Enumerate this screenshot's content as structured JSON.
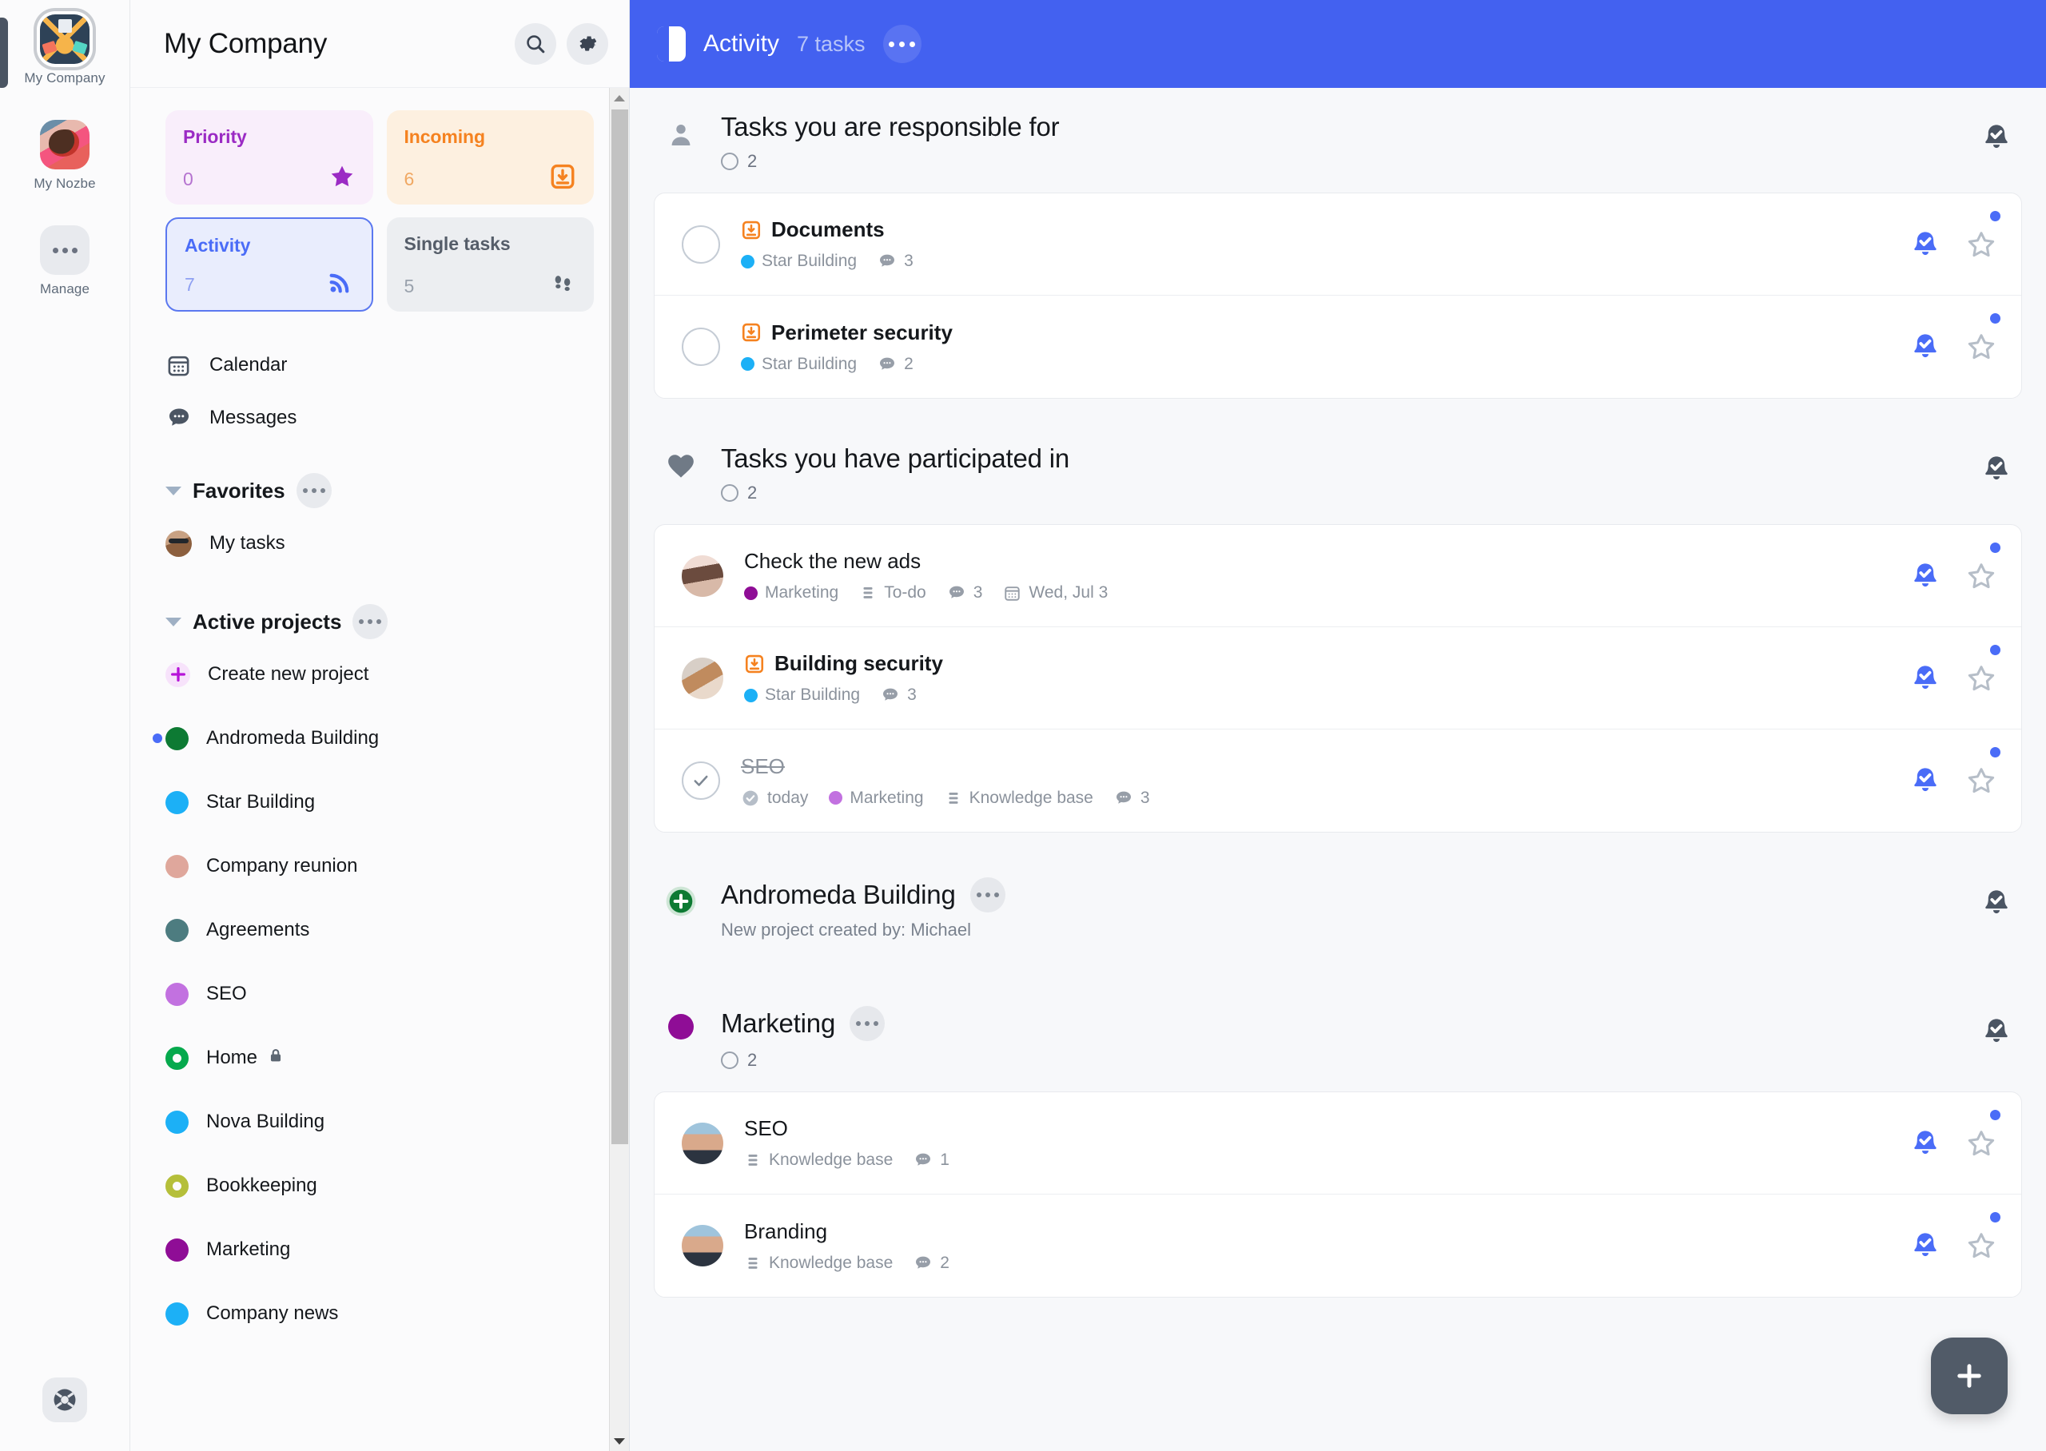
{
  "rail": {
    "items": [
      {
        "label": "My Company",
        "icon": "company-avatar",
        "selected": true
      },
      {
        "label": "My Nozbe",
        "icon": "nozbe-avatar",
        "selected": false
      },
      {
        "label": "Manage",
        "icon": "ellipsis-icon",
        "selected": false
      }
    ],
    "help_icon": "lifebuoy-icon"
  },
  "sidebar": {
    "title": "My Company",
    "search_icon": "search-icon",
    "settings_icon": "gear-icon",
    "tiles": [
      {
        "name": "Priority",
        "count": "0",
        "icon": "star-icon",
        "key": "priority"
      },
      {
        "name": "Incoming",
        "count": "6",
        "icon": "inbox-download-icon",
        "key": "incoming"
      },
      {
        "name": "Activity",
        "count": "7",
        "icon": "rss-icon",
        "key": "activity",
        "selected": true
      },
      {
        "name": "Single tasks",
        "count": "5",
        "icon": "footprints-icon",
        "key": "single"
      }
    ],
    "nav": [
      {
        "label": "Calendar",
        "icon": "calendar-icon"
      },
      {
        "label": "Messages",
        "icon": "chat-bubble-icon"
      }
    ],
    "favorites": {
      "title": "Favorites",
      "more_icon": "ellipsis-icon",
      "items": [
        {
          "label": "My tasks",
          "icon": "user-avatar"
        }
      ]
    },
    "active_projects": {
      "title": "Active projects",
      "more_icon": "ellipsis-icon",
      "create_label": "Create new project",
      "create_icon": "plus-icon",
      "items": [
        {
          "label": "Andromeda Building",
          "color": "#0d7a33",
          "style": "solid",
          "unread": true
        },
        {
          "label": "Star Building",
          "color": "#1cb0f6",
          "style": "solid",
          "unread": false
        },
        {
          "label": "Company reunion",
          "color": "#dfa79c",
          "style": "solid",
          "unread": false
        },
        {
          "label": "Agreements",
          "color": "#4d7c80",
          "style": "solid",
          "unread": false
        },
        {
          "label": "SEO",
          "color": "#c271e0",
          "style": "solid",
          "unread": false
        },
        {
          "label": "Home",
          "color": "#06a94d",
          "style": "ring",
          "unread": false,
          "lock": true
        },
        {
          "label": "Nova Building",
          "color": "#1cb0f6",
          "style": "solid",
          "unread": false
        },
        {
          "label": "Bookkeeping",
          "color": "#b5bf3a",
          "style": "ring",
          "unread": false
        },
        {
          "label": "Marketing",
          "color": "#8f0d96",
          "style": "solid",
          "unread": false
        },
        {
          "label": "Company news",
          "color": "#1cb0f6",
          "style": "solid",
          "unread": false
        }
      ]
    }
  },
  "topbar": {
    "panel_toggle_icon": "sidebar-toggle-icon",
    "title": "Activity",
    "subtitle": "7 tasks",
    "more_icon": "ellipsis-icon"
  },
  "main": {
    "groups": [
      {
        "kind": "section",
        "icon": "person-icon",
        "title": "Tasks you are responsible for",
        "count": "2",
        "bell_icon": "bell-check-icon",
        "tasks": [
          {
            "title": "Documents",
            "bold": true,
            "done": false,
            "lead_icon": "inbox-download-icon",
            "avatar": null,
            "meta": [
              {
                "type": "project",
                "label": "Star Building",
                "color": "#1cb0f6"
              },
              {
                "type": "comments",
                "label": "3"
              }
            ],
            "unread": true,
            "bell": "bell-check-icon",
            "star": "star-outline-icon"
          },
          {
            "title": "Perimeter security",
            "bold": true,
            "done": false,
            "lead_icon": "inbox-download-icon",
            "avatar": null,
            "meta": [
              {
                "type": "project",
                "label": "Star Building",
                "color": "#1cb0f6"
              },
              {
                "type": "comments",
                "label": "2"
              }
            ],
            "unread": true,
            "bell": "bell-check-icon",
            "star": "star-outline-icon"
          }
        ]
      },
      {
        "kind": "section",
        "icon": "heart-icon",
        "title": "Tasks you have participated in",
        "count": "2",
        "bell_icon": "bell-check-icon",
        "tasks": [
          {
            "title": "Check the new ads",
            "bold": false,
            "done": false,
            "lead_icon": null,
            "avatar": "woman-1",
            "meta": [
              {
                "type": "project",
                "label": "Marketing",
                "color": "#8f0d96"
              },
              {
                "type": "list",
                "label": "To-do"
              },
              {
                "type": "comments",
                "label": "3"
              },
              {
                "type": "date",
                "label": "Wed, Jul 3"
              }
            ],
            "unread": true,
            "bell": "bell-check-icon",
            "star": "star-outline-icon"
          },
          {
            "title": "Building security",
            "bold": true,
            "done": false,
            "lead_icon": "inbox-download-icon",
            "avatar": "woman-2",
            "meta": [
              {
                "type": "project",
                "label": "Star Building",
                "color": "#1cb0f6"
              },
              {
                "type": "comments",
                "label": "3"
              }
            ],
            "unread": true,
            "bell": "bell-check-icon",
            "star": "star-outline-icon"
          },
          {
            "title": "SEO",
            "bold": false,
            "done": true,
            "lead_icon": null,
            "avatar": null,
            "meta": [
              {
                "type": "done-date",
                "label": "today"
              },
              {
                "type": "project",
                "label": "Marketing",
                "color": "#c271e0"
              },
              {
                "type": "list",
                "label": "Knowledge base"
              },
              {
                "type": "comments",
                "label": "3"
              }
            ],
            "unread": true,
            "bell": "bell-check-icon",
            "star": "star-outline-icon"
          }
        ]
      },
      {
        "kind": "project-event",
        "icon": "plus-circle-icon",
        "icon_color": "#0d7a33",
        "title": "Andromeda Building",
        "more_icon": "ellipsis-icon",
        "subtitle": "New project created by: Michael",
        "bell_icon": "bell-check-icon",
        "tasks": []
      },
      {
        "kind": "project",
        "icon": "project-dot",
        "icon_color": "#8f0d96",
        "title": "Marketing",
        "more_icon": "ellipsis-icon",
        "count": "2",
        "bell_icon": "bell-check-icon",
        "tasks": [
          {
            "title": "SEO",
            "bold": false,
            "done": false,
            "lead_icon": null,
            "avatar": "man-1",
            "meta": [
              {
                "type": "list",
                "label": "Knowledge base"
              },
              {
                "type": "comments",
                "label": "1"
              }
            ],
            "unread": true,
            "bell": "bell-check-icon",
            "star": "star-outline-icon"
          },
          {
            "title": "Branding",
            "bold": false,
            "done": false,
            "lead_icon": null,
            "avatar": "man-1",
            "meta": [
              {
                "type": "list",
                "label": "Knowledge base"
              },
              {
                "type": "comments",
                "label": "2"
              }
            ],
            "unread": true,
            "bell": "bell-check-icon",
            "star": "star-outline-icon"
          }
        ]
      }
    ],
    "fab_icon": "plus-icon"
  },
  "colors": {
    "accent": "#4361f0",
    "bell_active": "#4a6cf7",
    "bell_inactive": "#4b5563",
    "unread_dot": "#4a6cf7"
  }
}
